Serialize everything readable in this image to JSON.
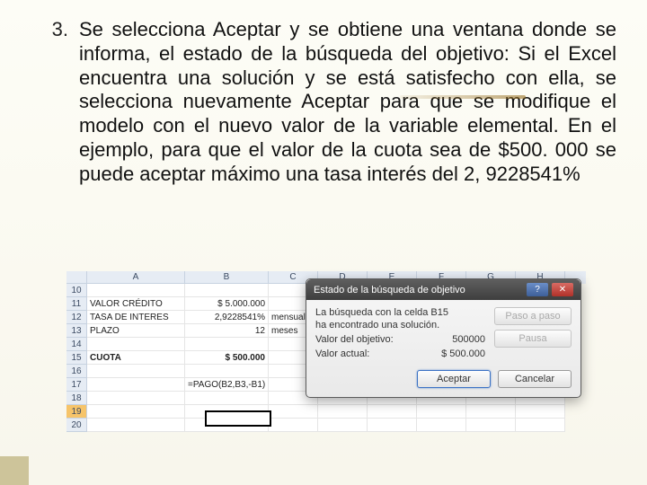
{
  "list": {
    "number": "3.",
    "text": "Se selecciona Aceptar y se obtiene una ventana donde se informa, el estado de la búsqueda del objetivo: Si el Excel encuentra una solución y se está satisfecho con ella, se selecciona nuevamente Aceptar para que se modifique el modelo con el nuevo valor de la variable elemental. En el ejemplo, para que el valor de la cuota sea de $500. 000 se puede aceptar máximo una tasa interés del 2, 9228541%"
  },
  "excel": {
    "cols": [
      "A",
      "B",
      "C",
      "D",
      "E",
      "F",
      "G",
      "H"
    ],
    "rows": [
      {
        "n": "10",
        "a": "",
        "b": "",
        "c": ""
      },
      {
        "n": "11",
        "a": "VALOR CRÉDITO",
        "b": "$ 5.000.000",
        "c": ""
      },
      {
        "n": "12",
        "a": "TASA DE INTERES",
        "b": "2,9228541%",
        "c": "mensual"
      },
      {
        "n": "13",
        "a": "PLAZO",
        "b": "12",
        "c": "meses"
      },
      {
        "n": "14",
        "a": "",
        "b": "",
        "c": ""
      },
      {
        "n": "15",
        "a": "CUOTA",
        "b": "$ 500.000",
        "c": "",
        "bold": true
      },
      {
        "n": "16",
        "a": "",
        "b": "",
        "c": ""
      },
      {
        "n": "17",
        "a": "",
        "b": "=PAGO(B2,B3,-B1)",
        "c": ""
      },
      {
        "n": "18",
        "a": "",
        "b": "",
        "c": ""
      },
      {
        "n": "19",
        "a": "",
        "b": "",
        "c": ""
      },
      {
        "n": "20",
        "a": "",
        "b": "",
        "c": ""
      }
    ]
  },
  "dialog": {
    "title": "Estado de la búsqueda de objetivo",
    "help_glyph": "?",
    "close_glyph": "✕",
    "line1": "La búsqueda con la celda B15",
    "line2": "ha encontrado una solución.",
    "target_label": "Valor del objetivo:",
    "target_value": "500000",
    "current_label": "Valor actual:",
    "current_value": "$ 500.000",
    "btn_step": "Paso a paso",
    "btn_pause": "Pausa",
    "btn_accept": "Aceptar",
    "btn_cancel": "Cancelar"
  }
}
